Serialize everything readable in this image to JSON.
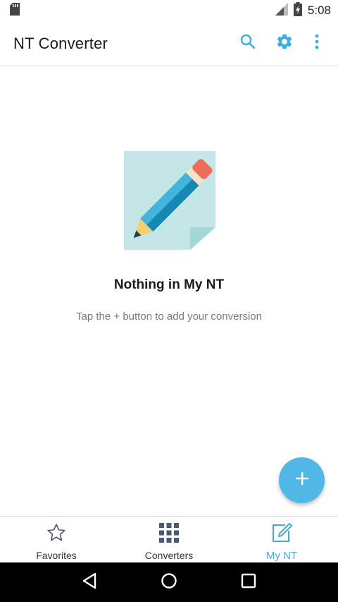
{
  "status_bar": {
    "time": "5:08",
    "icons": [
      "sd-card-icon",
      "signal-icon",
      "battery-charging-icon"
    ]
  },
  "app_bar": {
    "title": "NT Converter",
    "actions": [
      "search-icon",
      "gear-icon",
      "more-vert-icon"
    ]
  },
  "empty_state": {
    "illustration": "note-pencil-illustration",
    "title": "Nothing in My NT",
    "subtitle": "Tap the + button to add your conversion"
  },
  "fab": {
    "icon": "plus-icon"
  },
  "bottom_nav": {
    "items": [
      {
        "label": "Favorites",
        "icon": "star-icon",
        "active": false
      },
      {
        "label": "Converters",
        "icon": "grid-icon",
        "active": false
      },
      {
        "label": "My NT",
        "icon": "edit-note-icon",
        "active": true
      }
    ]
  },
  "system_nav": {
    "buttons": [
      "back-icon",
      "home-icon",
      "recents-icon"
    ]
  },
  "colors": {
    "accent": "#3aaee0",
    "fab": "#4fb8e6",
    "note": "#c4e6e7",
    "pencil_body": "#45b4dc",
    "eraser": "#ef6d5c"
  }
}
